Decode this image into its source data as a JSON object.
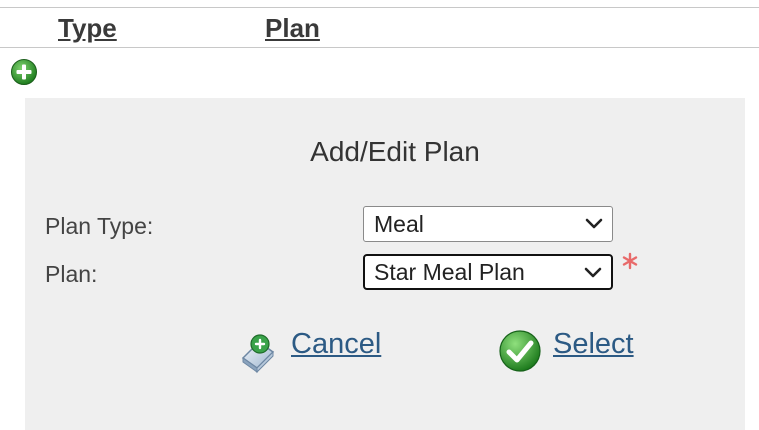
{
  "table": {
    "columns": [
      "Type",
      "Plan"
    ]
  },
  "add_button": {
    "icon": "plus-circle-icon",
    "color": "#2e9a2e"
  },
  "dialog": {
    "title": "Add/Edit Plan",
    "fields": {
      "plan_type": {
        "label": "Plan Type:",
        "value": "Meal"
      },
      "plan": {
        "label": "Plan:",
        "value": "Star Meal Plan",
        "required": true
      }
    },
    "actions": {
      "cancel": {
        "label": "Cancel",
        "icon": "cancel-icon"
      },
      "select": {
        "label": "Select",
        "icon": "check-icon"
      }
    }
  },
  "colors": {
    "panel_bg": "#efefef",
    "link": "#2c5a84",
    "required": "#e86a6a",
    "success": "#2e9a2e"
  }
}
